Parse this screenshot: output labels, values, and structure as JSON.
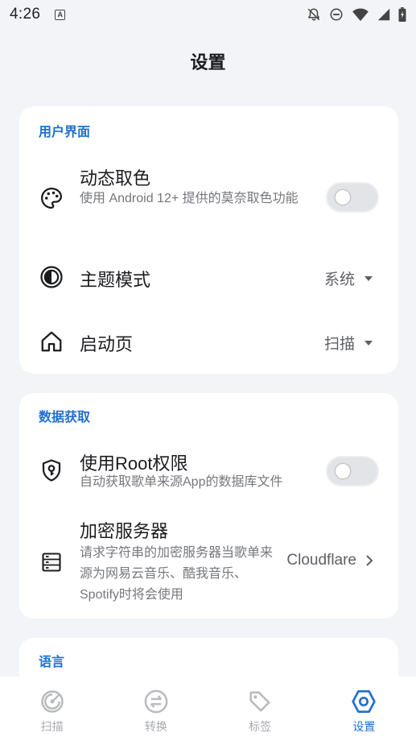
{
  "status_bar": {
    "time": "4:26",
    "a_badge": "A"
  },
  "page": {
    "title": "设置"
  },
  "ui_section": {
    "title": "用户界面",
    "dynamic_color": {
      "title": "动态取色",
      "subtitle": "使用 Android 12+ 提供的莫奈取色功能",
      "enabled": false
    },
    "theme_mode": {
      "title": "主题模式",
      "value": "系统"
    },
    "start_page": {
      "title": "启动页",
      "value": "扫描"
    }
  },
  "data_section": {
    "title": "数据获取",
    "root": {
      "title": "使用Root权限",
      "subtitle": "自动获取歌单来源App的数据库文件",
      "enabled": false
    },
    "encrypt_server": {
      "title": "加密服务器",
      "subtitle": "请求字符串的加密服务器当歌单来源为网易云音乐、酷我音乐、Spotify时将会使用",
      "value": "Cloudflare"
    }
  },
  "lang_section": {
    "title": "语言"
  },
  "bottom_nav": {
    "items": [
      {
        "label": "扫描",
        "icon": "scan-icon",
        "active": false
      },
      {
        "label": "转换",
        "icon": "convert-icon",
        "active": false
      },
      {
        "label": "标签",
        "icon": "tag-icon",
        "active": false
      },
      {
        "label": "设置",
        "icon": "settings-hex-icon",
        "active": true
      }
    ]
  },
  "colors": {
    "accent": "#1f6fd1",
    "inactive": "#a9abb0",
    "background": "#f3f4f7"
  }
}
